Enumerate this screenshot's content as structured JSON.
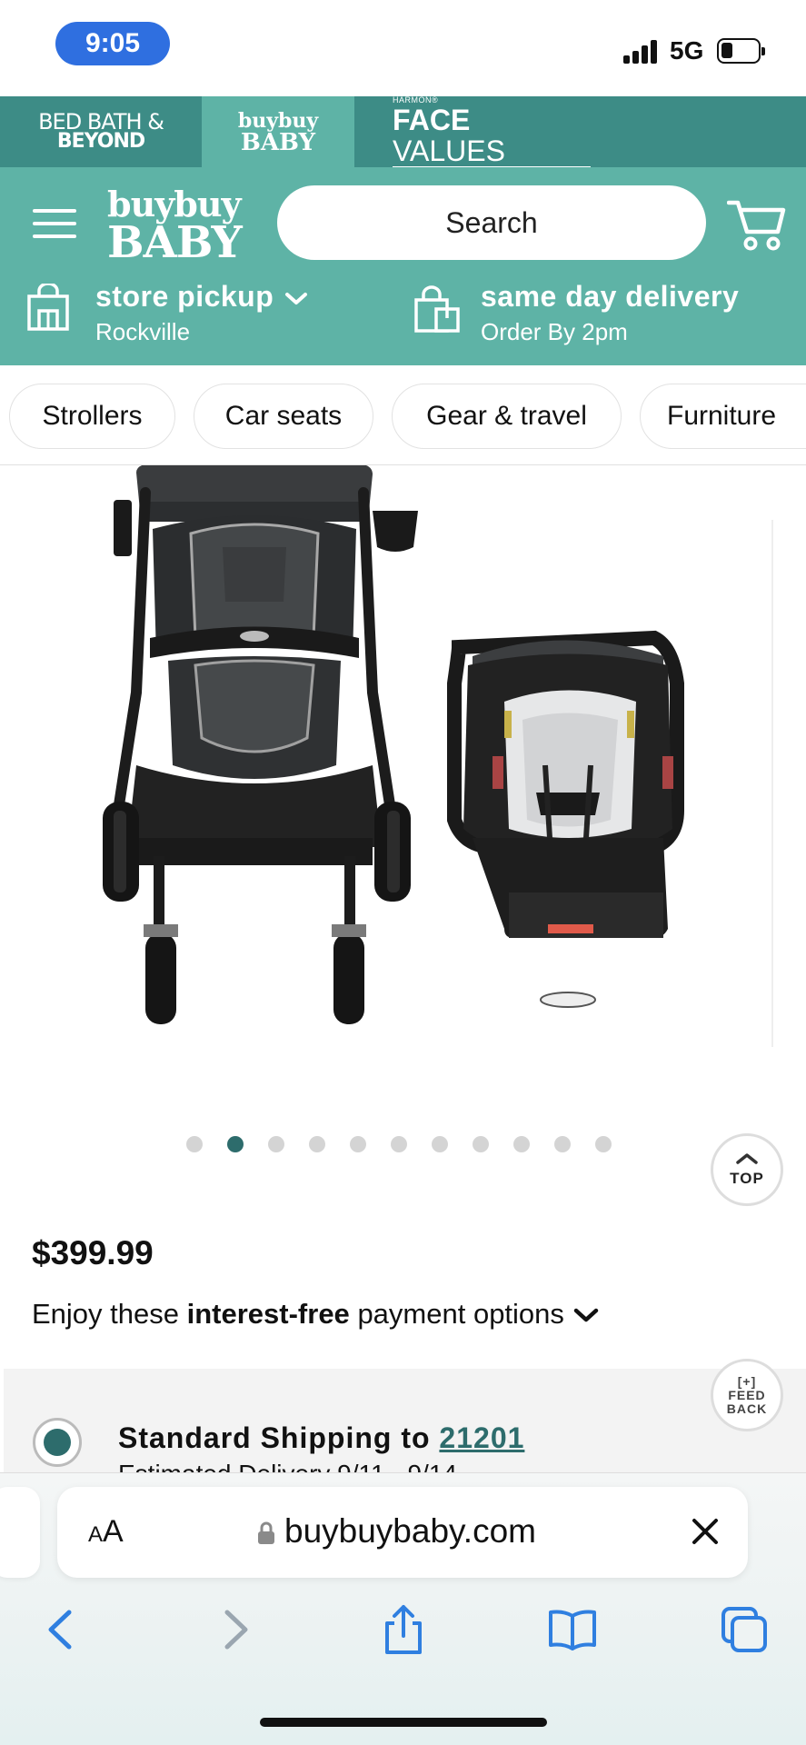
{
  "status_bar": {
    "time": "9:05",
    "network": "5G"
  },
  "brand_tabs": {
    "bed_bath_line1": "BED BATH &",
    "bed_bath_line2": "BEYOND",
    "buybuy_line1": "buybuy",
    "buybuy_line2": "BABY",
    "harmon": "HARMON®",
    "face": "FACE",
    "values": "VALUES"
  },
  "header": {
    "logo_line1": "buybuy",
    "logo_line2": "BABY",
    "search_placeholder": "Search",
    "pickup_title": "store pickup",
    "pickup_store": "Rockville",
    "delivery_title": "same day delivery",
    "delivery_sub": "Order By 2pm"
  },
  "categories": [
    "Strollers",
    "Car seats",
    "Gear & travel",
    "Furniture"
  ],
  "carousel": {
    "total_slides": 11,
    "active_index": 1
  },
  "top_button": "TOP",
  "product": {
    "price": "$399.99",
    "payment_prefix": "Enjoy these",
    "payment_bold": "interest-free",
    "payment_suffix": "payment options"
  },
  "shipping": {
    "title": "Standard Shipping to",
    "zip": "21201",
    "estimate": "Estimated Delivery 9/11 - 9/14"
  },
  "feedback": {
    "line1": "[+]",
    "line2": "FEED",
    "line3": "BACK"
  },
  "safari": {
    "aa_small": "A",
    "aa_large": "A",
    "url": "buybuybaby.com"
  },
  "colors": {
    "teal_dark": "#3d8c86",
    "teal": "#5eb3a6",
    "accent": "#2d6c6c",
    "safari_blue": "#2f7fe0"
  }
}
